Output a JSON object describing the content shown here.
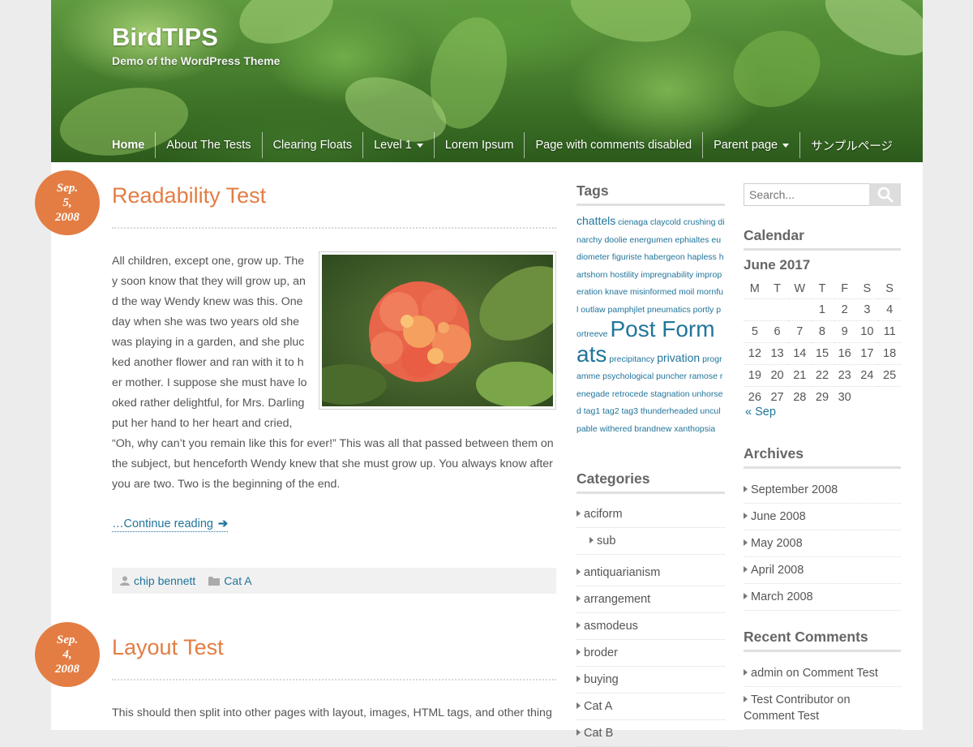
{
  "site": {
    "title": "BirdTIPS",
    "description": "Demo of the WordPress Theme"
  },
  "nav": [
    {
      "label": "Home",
      "dropdown": false
    },
    {
      "label": "About The Tests",
      "dropdown": false
    },
    {
      "label": "Clearing Floats",
      "dropdown": false
    },
    {
      "label": "Level 1",
      "dropdown": true
    },
    {
      "label": "Lorem Ipsum",
      "dropdown": false
    },
    {
      "label": "Page with comments disabled",
      "dropdown": false
    },
    {
      "label": "Parent page",
      "dropdown": true
    },
    {
      "label": "サンプルページ",
      "dropdown": false
    }
  ],
  "posts": [
    {
      "date": {
        "month": "Sep.",
        "day": "5,",
        "year": "2008"
      },
      "title": "Readability Test",
      "body": "All children, except one, grow up. They soon know that they will grow up, and the way Wendy knew was this. One day when she was two years old she was playing in a garden, and she plucked another flower and ran with it to her mother. I suppose she must have looked rather delightful, for Mrs. Darling put her hand to her heart and cried, “Oh, why can’t you remain like this for ever!” This was all that passed between them on the subject, but henceforth Wendy knew that she must grow up. You always know after you are two. Two is the beginning of the end.",
      "continue_label": "…Continue reading",
      "author": "chip bennett",
      "category": "Cat A"
    },
    {
      "date": {
        "month": "Sep.",
        "day": "4,",
        "year": "2008"
      },
      "title": "Layout Test",
      "body": "This should then split into other pages with layout, images, HTML tags, and other thing"
    }
  ],
  "tags_widget": {
    "title": "Tags",
    "tags": [
      {
        "text": "chattels",
        "size": 14
      },
      {
        "text": "cienaga",
        "size": 10.5
      },
      {
        "text": "claycold",
        "size": 10.5
      },
      {
        "text": "crushing",
        "size": 10.5
      },
      {
        "text": "dinarchy",
        "size": 10.5
      },
      {
        "text": "doolie",
        "size": 10.5
      },
      {
        "text": "energumen",
        "size": 10.5
      },
      {
        "text": "ephialtes",
        "size": 10.5
      },
      {
        "text": "eudiometer",
        "size": 10.5
      },
      {
        "text": "figuriste",
        "size": 10.5
      },
      {
        "text": "habergeon",
        "size": 10.5
      },
      {
        "text": "hapless",
        "size": 10.5
      },
      {
        "text": "hartshorn",
        "size": 10.5
      },
      {
        "text": "hostility",
        "size": 10.5
      },
      {
        "text": "impregnability",
        "size": 10.5
      },
      {
        "text": "improperation",
        "size": 10.5
      },
      {
        "text": "knave",
        "size": 10.5
      },
      {
        "text": "misinformed",
        "size": 10.5
      },
      {
        "text": "moil",
        "size": 10.5
      },
      {
        "text": "mornful",
        "size": 10.5
      },
      {
        "text": "outlaw",
        "size": 10.5
      },
      {
        "text": "pamphjlet",
        "size": 10.5
      },
      {
        "text": "pneumatics",
        "size": 10.5
      },
      {
        "text": "portly",
        "size": 10.5
      },
      {
        "text": "portreeve",
        "size": 10.5
      },
      {
        "text": "Post Formats",
        "size": 28
      },
      {
        "text": "precipitancy",
        "size": 10.5
      },
      {
        "text": "privation",
        "size": 14
      },
      {
        "text": "programme",
        "size": 10.5
      },
      {
        "text": "psychological",
        "size": 10.5
      },
      {
        "text": "puncher",
        "size": 10.5
      },
      {
        "text": "ramose",
        "size": 10.5
      },
      {
        "text": "renegade",
        "size": 10.5
      },
      {
        "text": "retrocede",
        "size": 10.5
      },
      {
        "text": "stagnation",
        "size": 10.5
      },
      {
        "text": "unhorsed",
        "size": 10.5
      },
      {
        "text": "tag1",
        "size": 10.5
      },
      {
        "text": "tag2",
        "size": 10.5
      },
      {
        "text": "tag3",
        "size": 10.5
      },
      {
        "text": "thunderheaded",
        "size": 10.5
      },
      {
        "text": "unculpable",
        "size": 10.5
      },
      {
        "text": "withered brandnew",
        "size": 10.5
      },
      {
        "text": "xanthopsia",
        "size": 10.5
      }
    ]
  },
  "categories_widget": {
    "title": "Categories",
    "items": [
      {
        "label": "aciform",
        "sub": false
      },
      {
        "label": "sub",
        "sub": true
      },
      {
        "label": "antiquarianism",
        "sub": false
      },
      {
        "label": "arrangement",
        "sub": false
      },
      {
        "label": "asmodeus",
        "sub": false
      },
      {
        "label": "broder",
        "sub": false
      },
      {
        "label": "buying",
        "sub": false
      },
      {
        "label": "Cat A",
        "sub": false
      },
      {
        "label": "Cat B",
        "sub": false
      }
    ]
  },
  "search": {
    "placeholder": "Search..."
  },
  "calendar": {
    "title": "Calendar",
    "month": "June 2017",
    "weekdays": [
      "M",
      "T",
      "W",
      "T",
      "F",
      "S",
      "S"
    ],
    "weeks": [
      [
        "",
        "",
        "",
        "1",
        "2",
        "3",
        "4"
      ],
      [
        "5",
        "6",
        "7",
        "8",
        "9",
        "10",
        "11"
      ],
      [
        "12",
        "13",
        "14",
        "15",
        "16",
        "17",
        "18"
      ],
      [
        "19",
        "20",
        "21",
        "22",
        "23",
        "24",
        "25"
      ],
      [
        "26",
        "27",
        "28",
        "29",
        "30",
        "",
        ""
      ]
    ],
    "prev_label": "« Sep"
  },
  "archives_widget": {
    "title": "Archives",
    "items": [
      "September 2008",
      "June 2008",
      "May 2008",
      "April 2008",
      "March 2008"
    ]
  },
  "recent_comments_widget": {
    "title": "Recent Comments",
    "items": [
      {
        "author": "admin",
        "on": "on",
        "post": "Comment Test"
      },
      {
        "author": "Test Contributor",
        "on": "on",
        "post": "Comment Test"
      }
    ]
  },
  "colors": {
    "accent": "#e37d43",
    "link": "#21759b",
    "text": "#555555"
  }
}
